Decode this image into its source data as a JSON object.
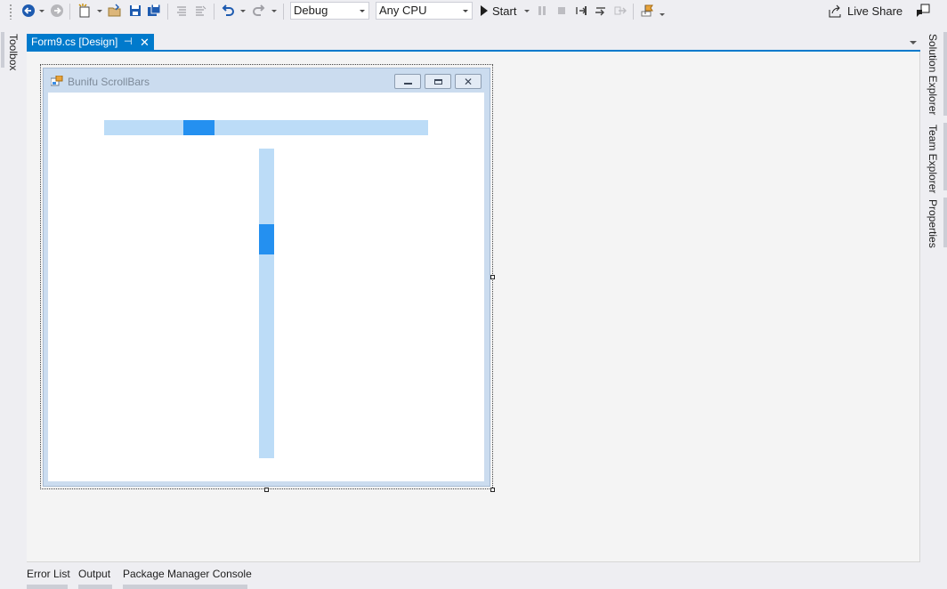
{
  "toolbar": {
    "configuration": "Debug",
    "platform": "Any CPU",
    "start_label": "Start",
    "live_share_label": "Live Share"
  },
  "side_tabs": {
    "left": [
      "Toolbox"
    ],
    "right": [
      "Solution Explorer",
      "Team Explorer",
      "Properties"
    ]
  },
  "document_tab": {
    "title": "Form9.cs [Design]"
  },
  "designer": {
    "form_title": "Bunifu ScrollBars",
    "hscroll_value_fraction": 0.27,
    "vscroll_value_fraction": 0.27
  },
  "bottom_tabs": [
    "Error List",
    "Output",
    "Package Manager Console"
  ],
  "colors": {
    "accent": "#007acc",
    "scroll_track": "#bcdcf7",
    "scroll_thumb": "#2490f0"
  }
}
